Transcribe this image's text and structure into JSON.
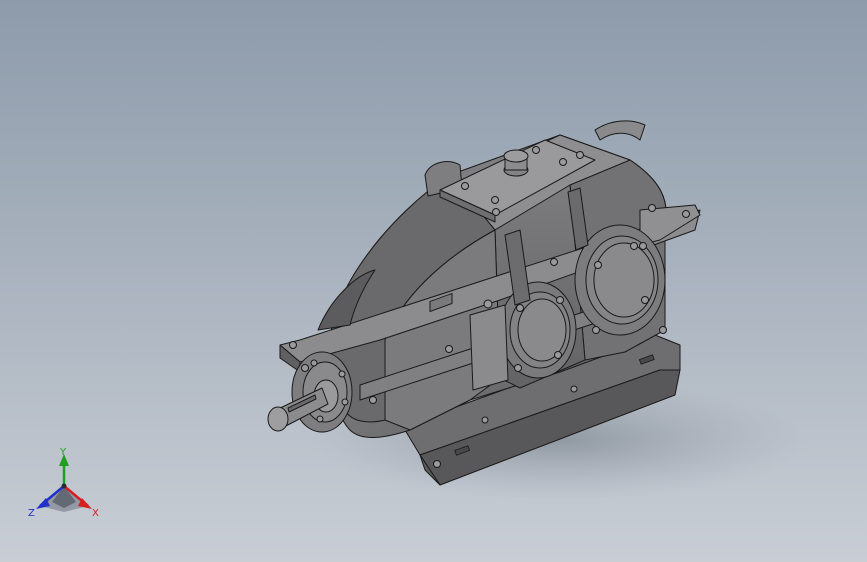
{
  "viewport": {
    "background_top": "#8d9bab",
    "background_bottom": "#c9ced5"
  },
  "model": {
    "body_color": "#7a7a7c",
    "shadow_color": "#4a4a4c",
    "edge_color": "#1a1a1a"
  },
  "triad": {
    "x_label": "X",
    "y_label": "Y",
    "z_label": "Z",
    "x_color": "#d42020",
    "y_color": "#20a020",
    "z_color": "#2030c8"
  }
}
